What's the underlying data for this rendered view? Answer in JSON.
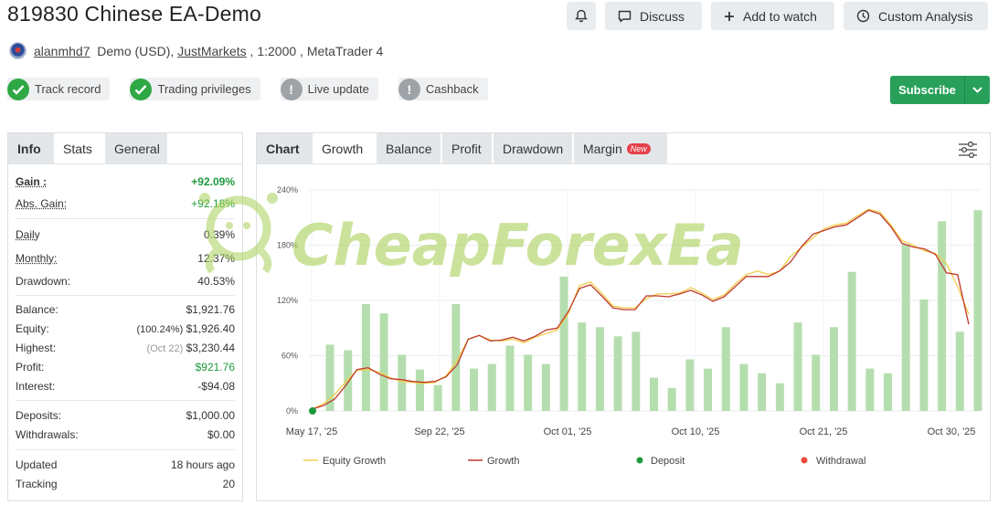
{
  "title": "819830 Chinese EA-Demo",
  "top_buttons": {
    "discuss": "Discuss",
    "add_to_watch": "Add to watch",
    "custom_analysis": "Custom Analysis"
  },
  "account": {
    "user": "alanmhd7",
    "account_type": "Demo (USD),",
    "broker": "JustMarkets",
    "leverage": ", 1:2000 , MetaTrader 4"
  },
  "badges": [
    {
      "label": "Track record",
      "status": "ok"
    },
    {
      "label": "Trading privileges",
      "status": "ok"
    },
    {
      "label": "Live update",
      "status": "na"
    },
    {
      "label": "Cashback",
      "status": "na"
    }
  ],
  "subscribe": {
    "label": "Subscribe"
  },
  "left_tabs": [
    "Info",
    "Stats",
    "General"
  ],
  "stats": {
    "gain_label": "Gain :",
    "gain": "+92.09%",
    "abs_gain_label": "Abs. Gain:",
    "abs_gain": "+92.18%",
    "daily_label": "Daily",
    "daily": "0.39%",
    "monthly_label": "Monthly:",
    "monthly": "12.37%",
    "drawdown_label": "Drawdown:",
    "drawdown": "40.53%",
    "balance_label": "Balance:",
    "balance": "$1,921.76",
    "equity_label": "Equity:",
    "equity_pct": "(100.24%)",
    "equity": "$1,926.40",
    "highest_label": "Highest:",
    "highest_date": "(Oct 22)",
    "highest": "$3,230.44",
    "profit_label": "Profit:",
    "profit": "$921.76",
    "interest_label": "Interest:",
    "interest": "-$94.08",
    "deposits_label": "Deposits:",
    "deposits": "$1,000.00",
    "withdrawals_label": "Withdrawals:",
    "withdrawals": "$0.00",
    "updated_label": "Updated",
    "updated": "18 hours ago",
    "tracking_label": "Tracking",
    "tracking": "20"
  },
  "chart_tabs": [
    "Chart",
    "Growth",
    "Balance",
    "Profit",
    "Drawdown",
    "Margin"
  ],
  "new_tag": "New",
  "watermark": "CheapForexEa",
  "colors": {
    "green_bar": "#b5deae",
    "equity_line": "#f2cd4a",
    "growth_line": "#c0392b",
    "deposit_dot": "#1e9a3d",
    "withdrawal_dot": "#e74c3c",
    "subscribe": "#28a05a"
  },
  "chart_data": {
    "type": "line",
    "title": "",
    "xlabel": "",
    "ylabel": "",
    "ylim": [
      0,
      240
    ],
    "yticks": [
      "0%",
      "60%",
      "120%",
      "180%",
      "240%"
    ],
    "xticks": [
      "May 17, '25",
      "Sep 22, '25",
      "Oct 01, '25",
      "Oct 10, '25",
      "Oct 21, '25",
      "Oct 30, '25"
    ],
    "legend": [
      "Equity Growth",
      "Growth",
      "Deposit",
      "Withdrawal"
    ],
    "legend_position": "bottom",
    "bars": [
      72,
      66,
      116,
      106,
      61,
      45,
      28,
      116,
      46,
      51,
      71,
      61,
      51,
      146,
      96,
      91,
      81,
      86,
      36,
      25,
      56,
      46,
      91,
      51,
      41,
      30,
      96,
      61,
      91,
      151,
      46,
      41,
      181,
      121,
      206,
      86,
      218
    ],
    "series": [
      {
        "name": "Equity Growth",
        "values": [
          2,
          8,
          18,
          32,
          44,
          45,
          42,
          36,
          32,
          31,
          30,
          31,
          38,
          55,
          78,
          82,
          77,
          76,
          78,
          74,
          80,
          84,
          88,
          106,
          136,
          140,
          128,
          114,
          112,
          112,
          122,
          127,
          127,
          128,
          134,
          128,
          121,
          126,
          138,
          148,
          152,
          148,
          152,
          168,
          178,
          188,
          198,
          202,
          204,
          212,
          219,
          216,
          202,
          185,
          180,
          174,
          171,
          160,
          135,
          105
        ]
      },
      {
        "name": "Growth",
        "values": [
          2,
          6,
          13,
          28,
          45,
          47,
          40,
          35,
          34,
          32,
          31,
          32,
          37,
          50,
          78,
          82,
          76,
          77,
          80,
          76,
          81,
          88,
          90,
          108,
          133,
          137,
          125,
          112,
          110,
          110,
          125,
          125,
          124,
          127,
          131,
          126,
          119,
          124,
          135,
          146,
          146,
          146,
          152,
          162,
          179,
          192,
          196,
          200,
          202,
          210,
          218,
          214,
          200,
          182,
          178,
          176,
          170,
          150,
          148,
          94
        ]
      }
    ],
    "deposits": [
      {
        "index": 0,
        "value": 0
      }
    ],
    "withdrawals": [
      {
        "index": 59,
        "value": 94
      }
    ]
  }
}
